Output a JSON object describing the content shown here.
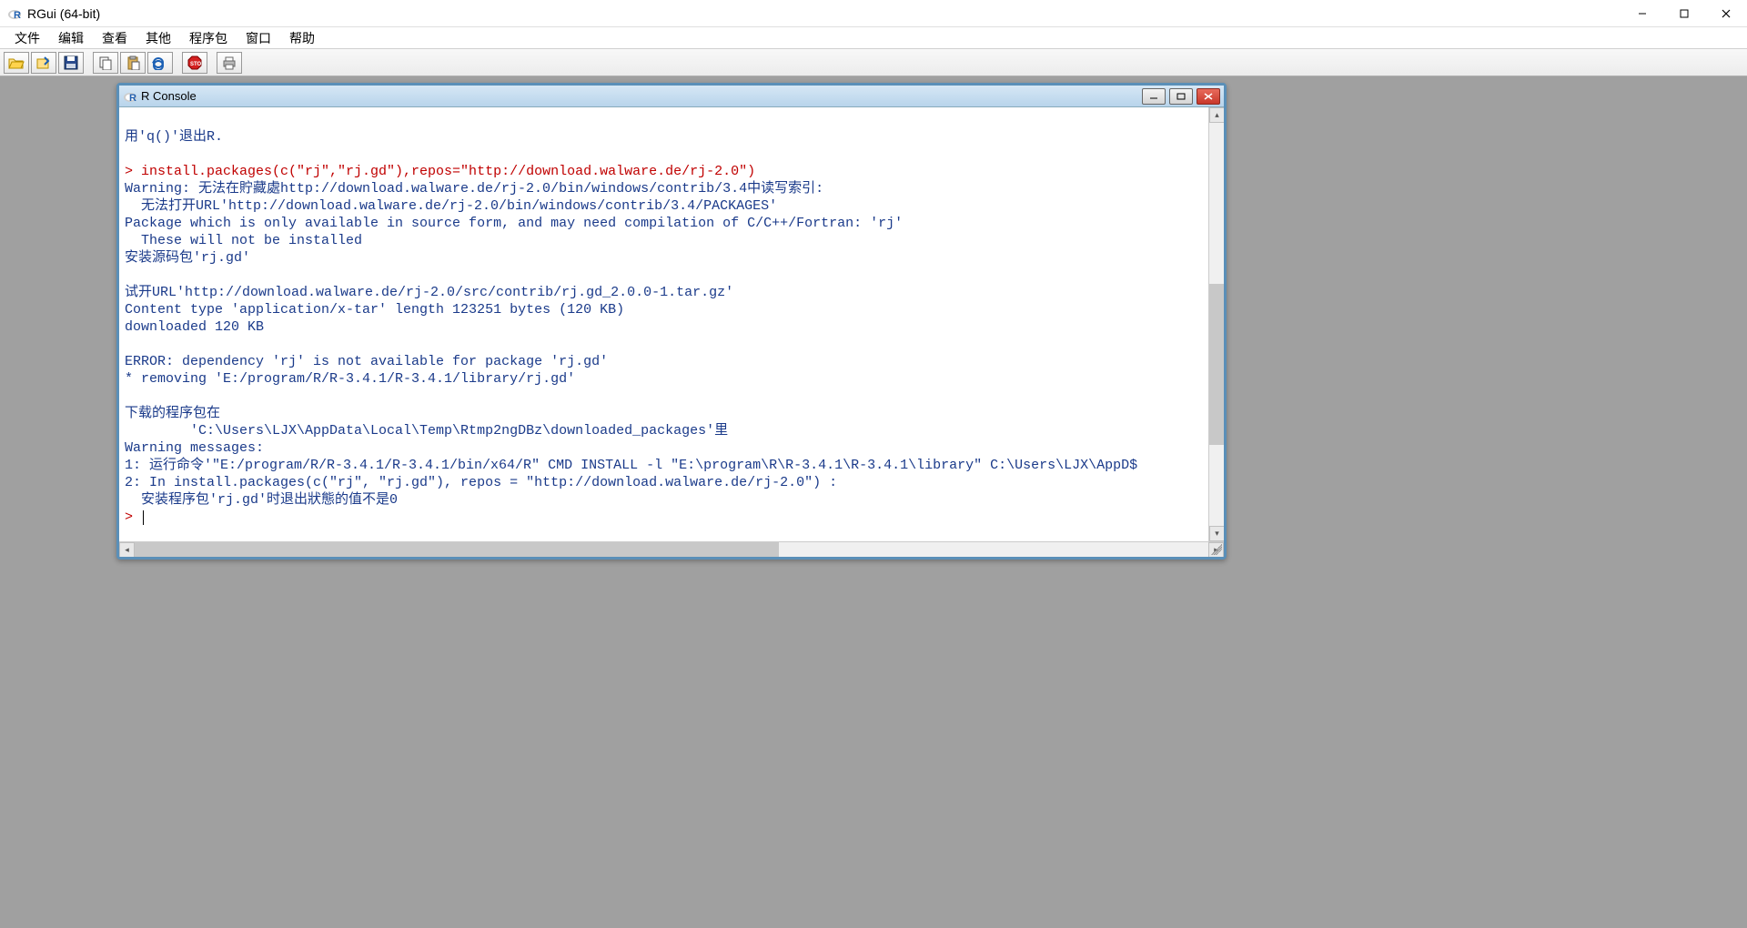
{
  "app": {
    "title": "RGui (64-bit)"
  },
  "menu": {
    "items": [
      "文件",
      "编辑",
      "查看",
      "其他",
      "程序包",
      "窗口",
      "帮助"
    ]
  },
  "toolbar": {
    "icons": [
      "open-script-icon",
      "load-workspace-icon",
      "save-workspace-icon",
      "copy-icon",
      "paste-icon",
      "copy-paste-icon",
      "stop-icon",
      "print-icon"
    ]
  },
  "console": {
    "title": "R Console",
    "lines": [
      {
        "t": "plain",
        "text": ""
      },
      {
        "t": "plain",
        "text": "用'q()'退出R."
      },
      {
        "t": "plain",
        "text": ""
      },
      {
        "t": "cmd",
        "text": "> install.packages(c(\"rj\",\"rj.gd\"),repos=\"http://download.walware.de/rj-2.0\")"
      },
      {
        "t": "plain",
        "text": "Warning: 无法在貯藏處http://download.walware.de/rj-2.0/bin/windows/contrib/3.4中读写索引:"
      },
      {
        "t": "plain",
        "text": "  无法打开URL'http://download.walware.de/rj-2.0/bin/windows/contrib/3.4/PACKAGES'"
      },
      {
        "t": "plain",
        "text": "Package which is only available in source form, and may need compilation of C/C++/Fortran: 'rj'"
      },
      {
        "t": "plain",
        "text": "  These will not be installed"
      },
      {
        "t": "plain",
        "text": "安装源码包'rj.gd'"
      },
      {
        "t": "plain",
        "text": ""
      },
      {
        "t": "plain",
        "text": "试开URL'http://download.walware.de/rj-2.0/src/contrib/rj.gd_2.0.0-1.tar.gz'"
      },
      {
        "t": "plain",
        "text": "Content type 'application/x-tar' length 123251 bytes (120 KB)"
      },
      {
        "t": "plain",
        "text": "downloaded 120 KB"
      },
      {
        "t": "plain",
        "text": ""
      },
      {
        "t": "plain",
        "text": "ERROR: dependency 'rj' is not available for package 'rj.gd'"
      },
      {
        "t": "plain",
        "text": "* removing 'E:/program/R/R-3.4.1/R-3.4.1/library/rj.gd'"
      },
      {
        "t": "plain",
        "text": ""
      },
      {
        "t": "plain",
        "text": "下载的程序包在"
      },
      {
        "t": "plain",
        "text": "        'C:\\Users\\LJX\\AppData\\Local\\Temp\\Rtmp2ngDBz\\downloaded_packages'里"
      },
      {
        "t": "plain",
        "text": "Warning messages:"
      },
      {
        "t": "plain",
        "text": "1: 运行命令'\"E:/program/R/R-3.4.1/R-3.4.1/bin/x64/R\" CMD INSTALL -l \"E:\\program\\R\\R-3.4.1\\R-3.4.1\\library\" C:\\Users\\LJX\\AppD$"
      },
      {
        "t": "plain",
        "text": "2: In install.packages(c(\"rj\", \"rj.gd\"), repos = \"http://download.walware.de/rj-2.0\") :"
      },
      {
        "t": "plain",
        "text": "  安装程序包'rj.gd'时退出狀態的值不是0"
      }
    ],
    "prompt": "> "
  }
}
